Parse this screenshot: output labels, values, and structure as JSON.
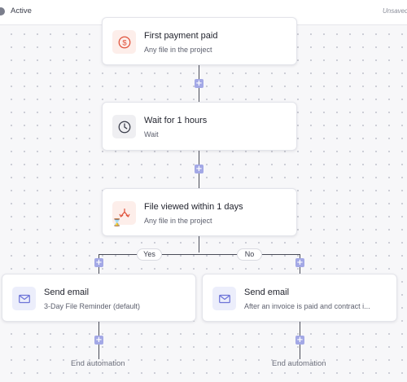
{
  "header": {
    "status": "Active",
    "save_state": "Unsaved"
  },
  "flow": {
    "trigger": {
      "title": "First payment paid",
      "subtitle": "Any file in the project",
      "icon": "dollar-circle-icon"
    },
    "wait": {
      "title": "Wait for 1 hours",
      "subtitle": "Wait",
      "icon": "clock-icon"
    },
    "condition": {
      "title": "File viewed within 1 days",
      "subtitle": "Any file in the project",
      "icon": "branch-split-icon"
    },
    "branches": {
      "yes_label": "Yes",
      "no_label": "No"
    },
    "yes_action": {
      "title": "Send email",
      "subtitle": "3-Day File Reminder (default)",
      "icon": "envelope-icon"
    },
    "no_action": {
      "title": "Send email",
      "subtitle": "After an invoice is paid and contract i...",
      "icon": "envelope-icon"
    },
    "end_label": "End automation",
    "add_step_symbol": "+"
  },
  "colors": {
    "accent_red": "#e0533c",
    "accent_blue": "#6d74d8",
    "plus_button": "#a3a8e6",
    "connector": "#4a4c58"
  }
}
